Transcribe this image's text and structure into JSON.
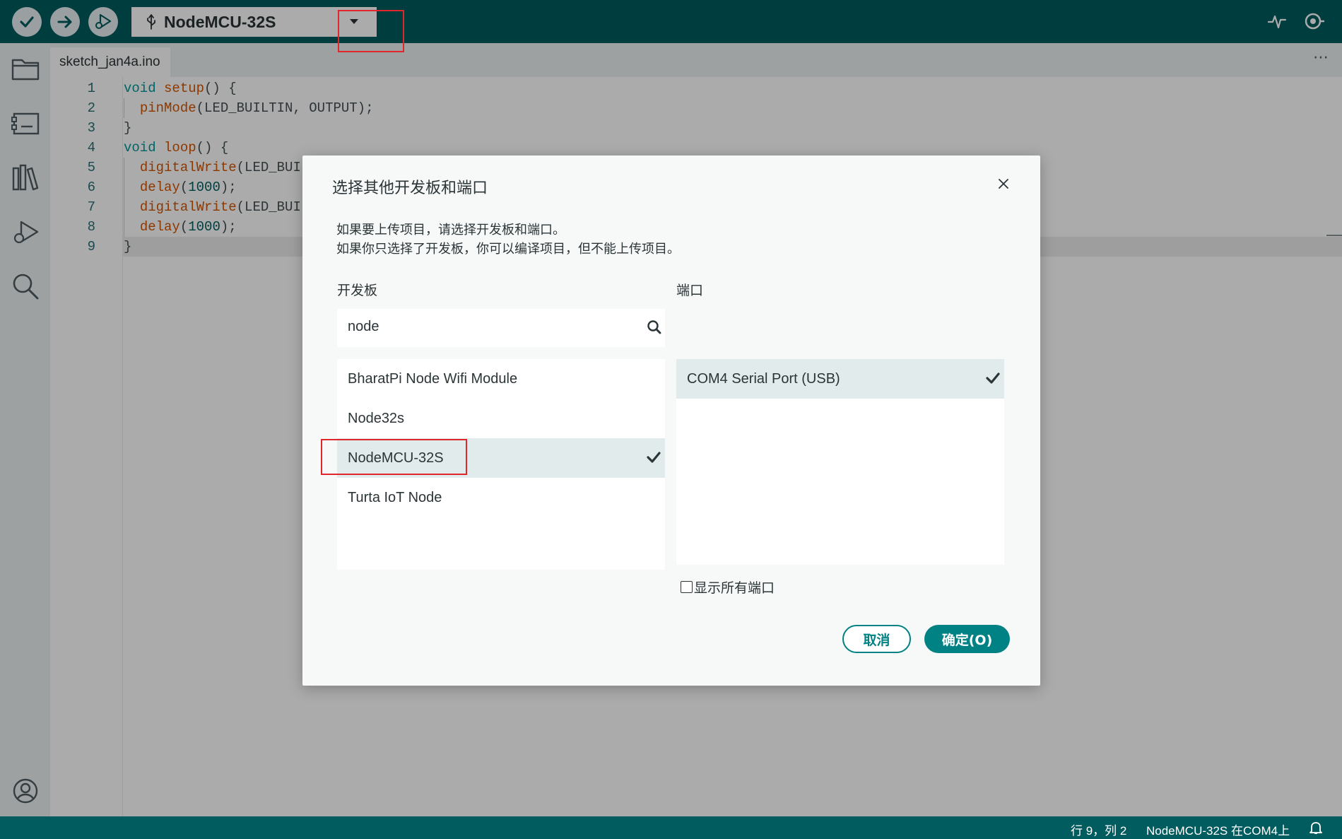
{
  "toolbar": {
    "verify_icon": "check-icon",
    "upload_icon": "arrow-right-icon",
    "debug_icon": "debug-icon",
    "board_selector": {
      "icon": "usb-icon",
      "label": "NodeMCU-32S",
      "dropdown_icon": "caret-down-icon"
    },
    "serial_plotter_icon": "serial-plotter-icon",
    "serial_monitor_icon": "serial-monitor-icon"
  },
  "sidebar": {
    "items": [
      "folder-icon",
      "board-manager-icon",
      "library-icon",
      "debug-icon",
      "search-icon"
    ],
    "bottom": "profile-icon"
  },
  "tabs": [
    {
      "label": "sketch_jan4a.ino"
    }
  ],
  "more_label": "⋯",
  "editor": {
    "current_line": 9,
    "lines": [
      {
        "n": "1",
        "segments": [
          [
            "kw",
            "void"
          ],
          [
            "plain",
            " "
          ],
          [
            "fn",
            "setup"
          ],
          [
            "plain",
            "() {"
          ]
        ]
      },
      {
        "n": "2",
        "segments": [
          [
            "plain",
            "  "
          ],
          [
            "fn",
            "pinMode"
          ],
          [
            "plain",
            "(LED_BUILTIN, OUTPUT);"
          ]
        ]
      },
      {
        "n": "3",
        "segments": [
          [
            "plain",
            "}"
          ]
        ]
      },
      {
        "n": "4",
        "segments": [
          [
            "kw",
            "void"
          ],
          [
            "plain",
            " "
          ],
          [
            "fn",
            "loop"
          ],
          [
            "plain",
            "() {"
          ]
        ]
      },
      {
        "n": "5",
        "segments": [
          [
            "plain",
            "  "
          ],
          [
            "fn",
            "digitalWrite"
          ],
          [
            "plain",
            "(LED_BUI"
          ]
        ]
      },
      {
        "n": "6",
        "segments": [
          [
            "plain",
            "  "
          ],
          [
            "fn",
            "delay"
          ],
          [
            "plain",
            "("
          ],
          [
            "num",
            "1000"
          ],
          [
            "plain",
            ");"
          ]
        ]
      },
      {
        "n": "7",
        "segments": [
          [
            "plain",
            "  "
          ],
          [
            "fn",
            "digitalWrite"
          ],
          [
            "plain",
            "(LED_BUI"
          ]
        ]
      },
      {
        "n": "8",
        "segments": [
          [
            "plain",
            "  "
          ],
          [
            "fn",
            "delay"
          ],
          [
            "plain",
            "("
          ],
          [
            "num",
            "1000"
          ],
          [
            "plain",
            ");"
          ]
        ]
      },
      {
        "n": "9",
        "segments": [
          [
            "plain",
            "}"
          ]
        ]
      }
    ]
  },
  "dialog": {
    "title": "选择其他开发板和端口",
    "close_icon": "close-icon",
    "desc_line1": "如果要上传项目，请选择开发板和端口。",
    "desc_line2": "如果你只选择了开发板，你可以编译项目，但不能上传项目。",
    "boards_label": "开发板",
    "ports_label": "端口",
    "search_value": "node",
    "boards": [
      {
        "label": "BharatPi Node Wifi Module",
        "selected": false
      },
      {
        "label": "Node32s",
        "selected": false
      },
      {
        "label": "NodeMCU-32S",
        "selected": true
      },
      {
        "label": "Turta IoT Node",
        "selected": false
      }
    ],
    "ports": [
      {
        "label": "COM4 Serial Port (USB)",
        "selected": true
      }
    ],
    "show_all_ports_label": "显示所有端口",
    "show_all_ports_checked": false,
    "cancel_label": "取消",
    "ok_label": "确定(O)"
  },
  "status": {
    "position": "行 9，列 2",
    "board_port": "NodeMCU-32S 在COM4上",
    "bell_icon": "bell-icon"
  },
  "colors": {
    "brand": "#005c5f",
    "accent": "#008184",
    "highlight": "#e0262b"
  }
}
